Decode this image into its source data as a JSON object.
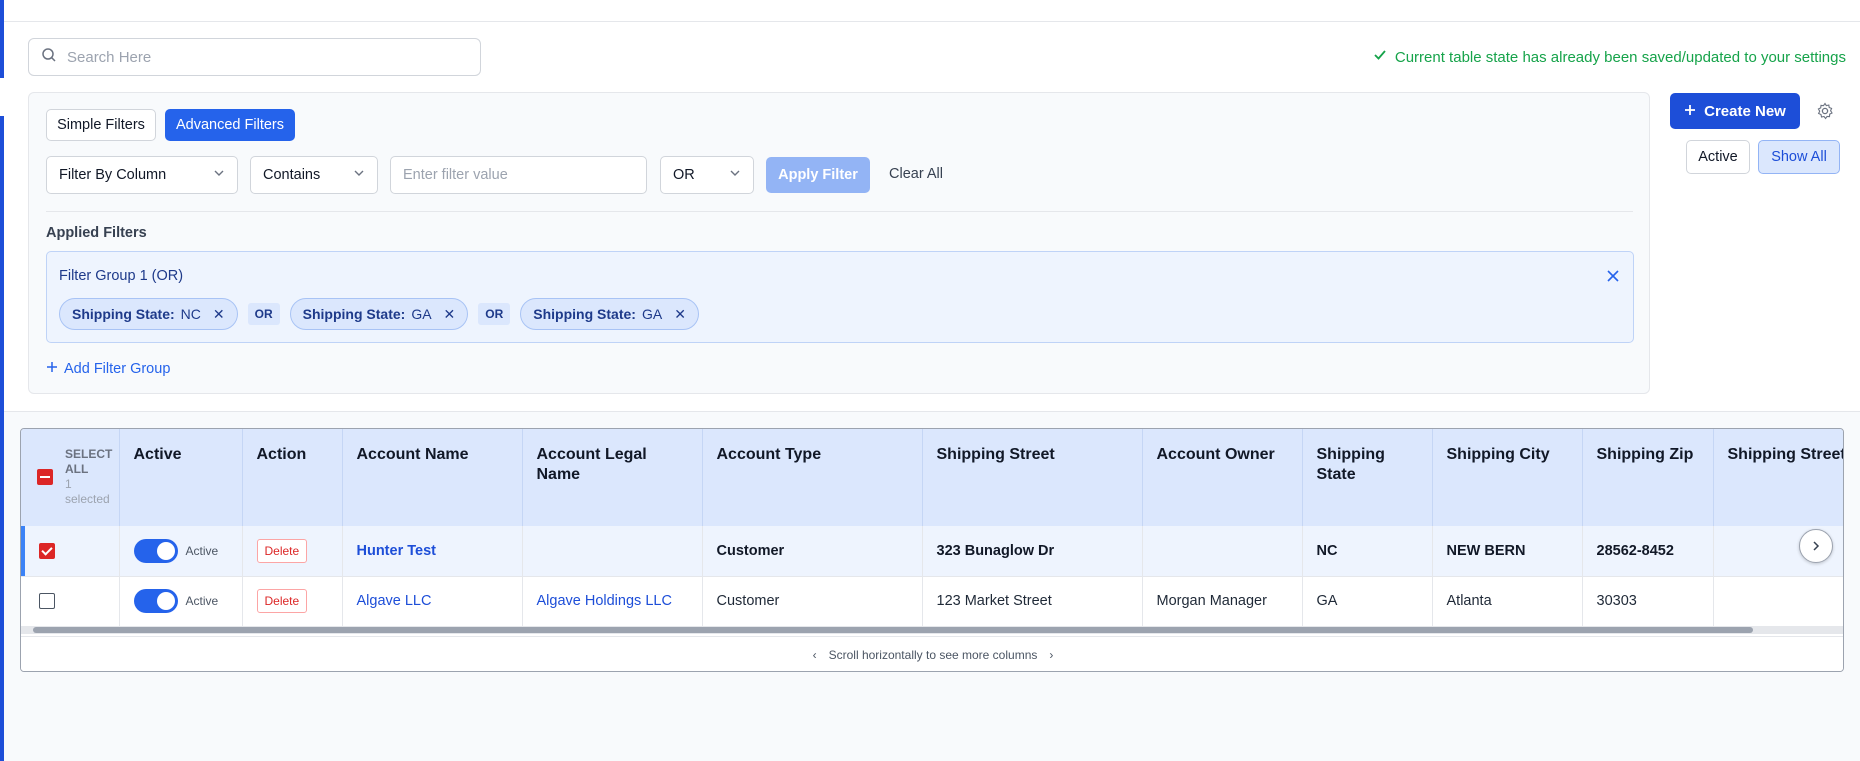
{
  "search": {
    "placeholder": "Search Here"
  },
  "status": {
    "saved_message": "Current table state has already been saved/updated to your settings"
  },
  "filters": {
    "tabs": {
      "simple": "Simple Filters",
      "advanced": "Advanced Filters"
    },
    "column_select": "Filter By Column",
    "operator_select": "Contains",
    "value_placeholder": "Enter filter value",
    "logic_select": "OR",
    "apply_label": "Apply Filter",
    "clear_label": "Clear All",
    "applied_label": "Applied Filters",
    "group": {
      "title": "Filter Group 1 (OR)",
      "chips": [
        {
          "field": "Shipping State:",
          "value": "NC"
        },
        {
          "field": "Shipping State:",
          "value": "GA"
        },
        {
          "field": "Shipping State:",
          "value": "GA"
        }
      ],
      "connector": "OR"
    },
    "add_group_label": "Add Filter Group"
  },
  "actions": {
    "create_label": "Create New",
    "view_active": "Active",
    "view_all": "Show All"
  },
  "table": {
    "select_all": {
      "label_line1": "SELECT",
      "label_line2": "ALL",
      "count_line1": "1",
      "count_line2": "selected"
    },
    "columns": [
      "Active",
      "Action",
      "Account Name",
      "Account Legal Name",
      "Account Type",
      "Shipping Street",
      "Account Owner",
      "Shipping State",
      "Shipping City",
      "Shipping Zip",
      "Shipping Street"
    ],
    "rows": [
      {
        "checked": true,
        "active_label": "Active",
        "delete_label": "Delete",
        "account_name": "Hunter Test",
        "legal_name": "",
        "type": "Customer",
        "street": "323 Bunaglow Dr",
        "owner": "",
        "state": "NC",
        "city": "NEW BERN",
        "zip": "28562-8452"
      },
      {
        "checked": false,
        "active_label": "Active",
        "delete_label": "Delete",
        "account_name": "Algave LLC",
        "legal_name": "Algave Holdings LLC",
        "type": "Customer",
        "street": "123 Market Street",
        "owner": "Morgan Manager",
        "state": "GA",
        "city": "Atlanta",
        "zip": "30303"
      }
    ],
    "scroll_hint": "Scroll horizontally to see more columns"
  },
  "colors": {
    "accent": "#2563eb",
    "success": "#16a34a",
    "danger": "#dc2626",
    "header_bg": "#dbe7fd"
  }
}
